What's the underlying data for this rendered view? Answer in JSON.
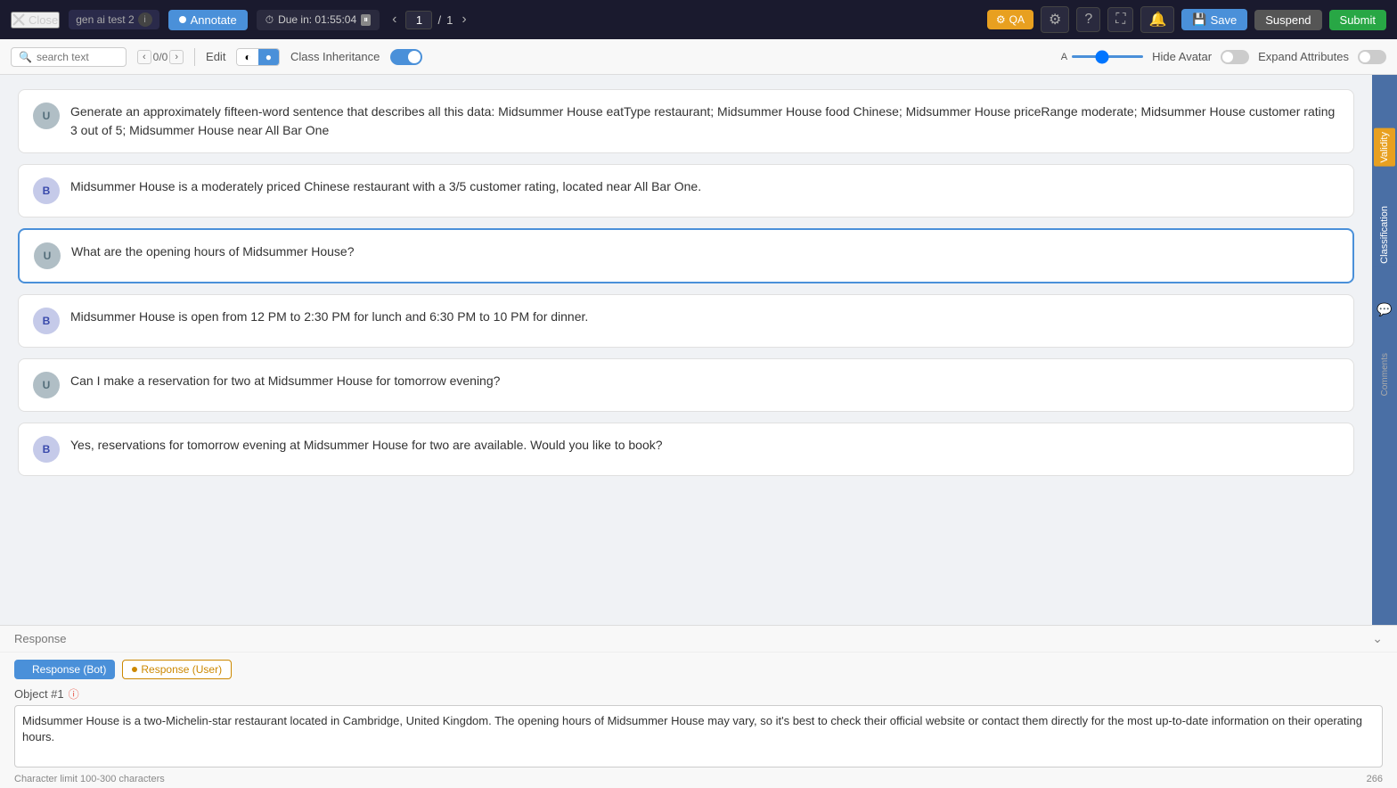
{
  "topbar": {
    "close_label": "Close",
    "project_name": "gen ai test 2",
    "annotate_label": "Annotate",
    "due_label": "Due in: 01:55:04",
    "page_current": "1",
    "page_total": "1",
    "qa_label": "QA",
    "save_label": "Save",
    "suspend_label": "Suspend",
    "submit_label": "Submit"
  },
  "toolbar": {
    "search_placeholder": "search text",
    "nav_count": "0/0",
    "edit_label": "Edit",
    "toggle_left": "◐",
    "toggle_right": "●",
    "class_inheritance_label": "Class Inheritance",
    "hide_avatar_label": "Hide Avatar",
    "expand_attributes_label": "Expand Attributes"
  },
  "messages": [
    {
      "role": "U",
      "avatar_type": "user",
      "text": "Generate an approximately fifteen-word sentence that describes all this data: Midsummer House eatType restaurant; Midsummer House food Chinese; Midsummer House priceRange moderate; Midsummer House customer rating 3 out of 5; Midsummer House near All Bar One",
      "selected": false
    },
    {
      "role": "B",
      "avatar_type": "bot",
      "text": "Midsummer House is a moderately priced Chinese restaurant with a 3/5 customer rating, located near All Bar One.",
      "selected": false
    },
    {
      "role": "U",
      "avatar_type": "user",
      "text": "What are the opening hours of Midsummer House?",
      "selected": true
    },
    {
      "role": "B",
      "avatar_type": "bot",
      "text": "Midsummer House is open from 12 PM to 2:30 PM for lunch and 6:30 PM to 10 PM for dinner.",
      "selected": false
    },
    {
      "role": "U",
      "avatar_type": "user",
      "text": "Can I make a reservation for two at Midsummer House for tomorrow evening?",
      "selected": false
    },
    {
      "role": "B",
      "avatar_type": "bot",
      "text": "Yes, reservations for tomorrow evening at Midsummer House for two are available. Would you like to book?",
      "selected": false
    }
  ],
  "bottom": {
    "response_label": "Response",
    "tab_bot_label": "Response (Bot)",
    "tab_user_label": "Response (User)",
    "object_label": "Object #1",
    "textarea_value": "Midsummer House is a two-Michelin-star restaurant located in Cambridge, United Kingdom. The opening hours of Midsummer House may vary, so it's best to check their official website or contact them directly for the most up-to-date information on their operating hours.",
    "char_limit_label": "Character limit 100-300 characters",
    "char_count": "266"
  },
  "right_panel": {
    "validity_label": "Validity",
    "classification_label": "Classification",
    "comments_label": "Comments"
  }
}
